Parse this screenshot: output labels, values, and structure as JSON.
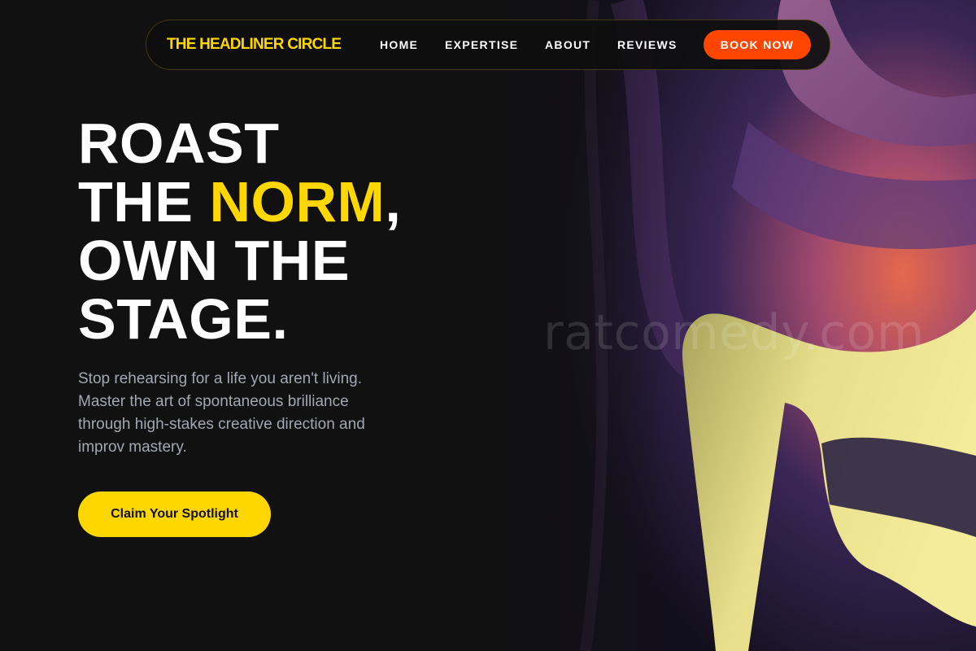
{
  "nav": {
    "brand": "THE HEADLINER CIRCLE",
    "links": [
      "HOME",
      "EXPERTISE",
      "ABOUT",
      "REVIEWS"
    ],
    "cta_label": "BOOK NOW"
  },
  "hero": {
    "line1": "ROAST",
    "line2_prefix": "THE ",
    "line2_accent": "NORM",
    "line2_suffix": ",",
    "line3": "OWN THE",
    "line4": "STAGE.",
    "description": "Stop rehearsing for a life you aren't living. Master the art of spontaneous brilliance through high-stakes creative direction and improv mastery.",
    "cta_label": "Claim Your Spotlight",
    "image_watermark": "ratcomedy.com"
  },
  "colors": {
    "background": "#111112",
    "accent_yellow": "#FFD700",
    "accent_orange": "#FF4500",
    "body_text": "#a3a7b2"
  }
}
